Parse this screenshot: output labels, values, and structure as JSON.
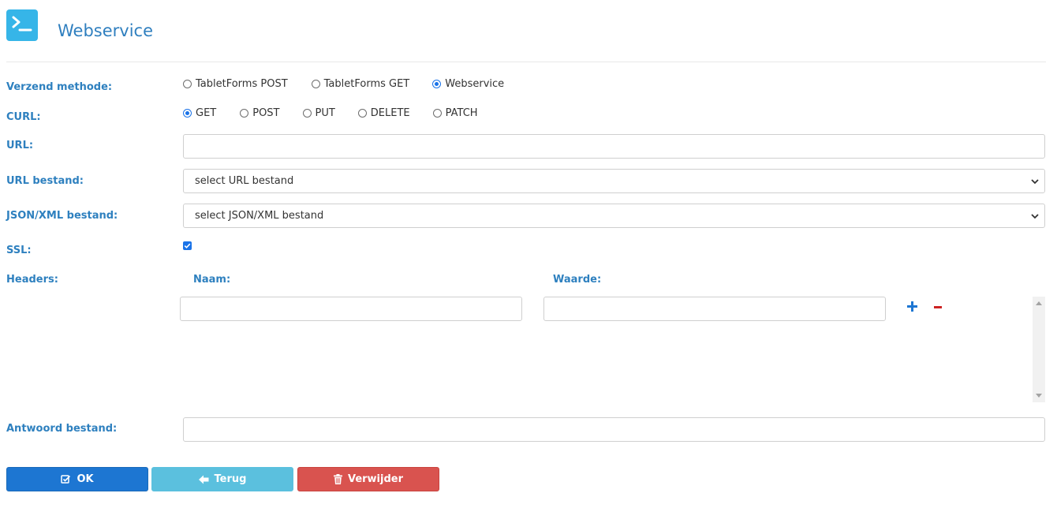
{
  "header": {
    "title": "Webservice",
    "icon": "terminal-icon",
    "icon_color": "#36b5e8"
  },
  "form": {
    "verzend": {
      "label": "Verzend methode:",
      "options": [
        "TabletForms POST",
        "TabletForms GET",
        "Webservice"
      ],
      "selected": "Webservice"
    },
    "curl": {
      "label": "CURL:",
      "options": [
        "GET",
        "POST",
        "PUT",
        "DELETE",
        "PATCH"
      ],
      "selected": "GET"
    },
    "url": {
      "label": "URL:",
      "value": ""
    },
    "url_bestand": {
      "label": "URL bestand:",
      "selected": "select URL bestand"
    },
    "json_xml_bestand": {
      "label": "JSON/XML bestand:",
      "selected": "select JSON/XML bestand"
    },
    "ssl": {
      "label": "SSL:",
      "checked": true
    },
    "headers": {
      "label": "Headers:",
      "naam_label": "Naam:",
      "waarde_label": "Waarde:",
      "rows": [
        {
          "naam": "",
          "waarde": ""
        }
      ]
    },
    "antwoord_bestand": {
      "label": "Antwoord bestand:",
      "value": ""
    }
  },
  "buttons": {
    "ok": "OK",
    "terug": "Terug",
    "verwijder": "Verwijder"
  },
  "colors": {
    "label": "#2e80bf",
    "ok": "#1d76d2",
    "terug": "#5bc0de",
    "verwijder": "#d9534f",
    "plus": "#1d76d2",
    "minus": "#cc2222"
  }
}
